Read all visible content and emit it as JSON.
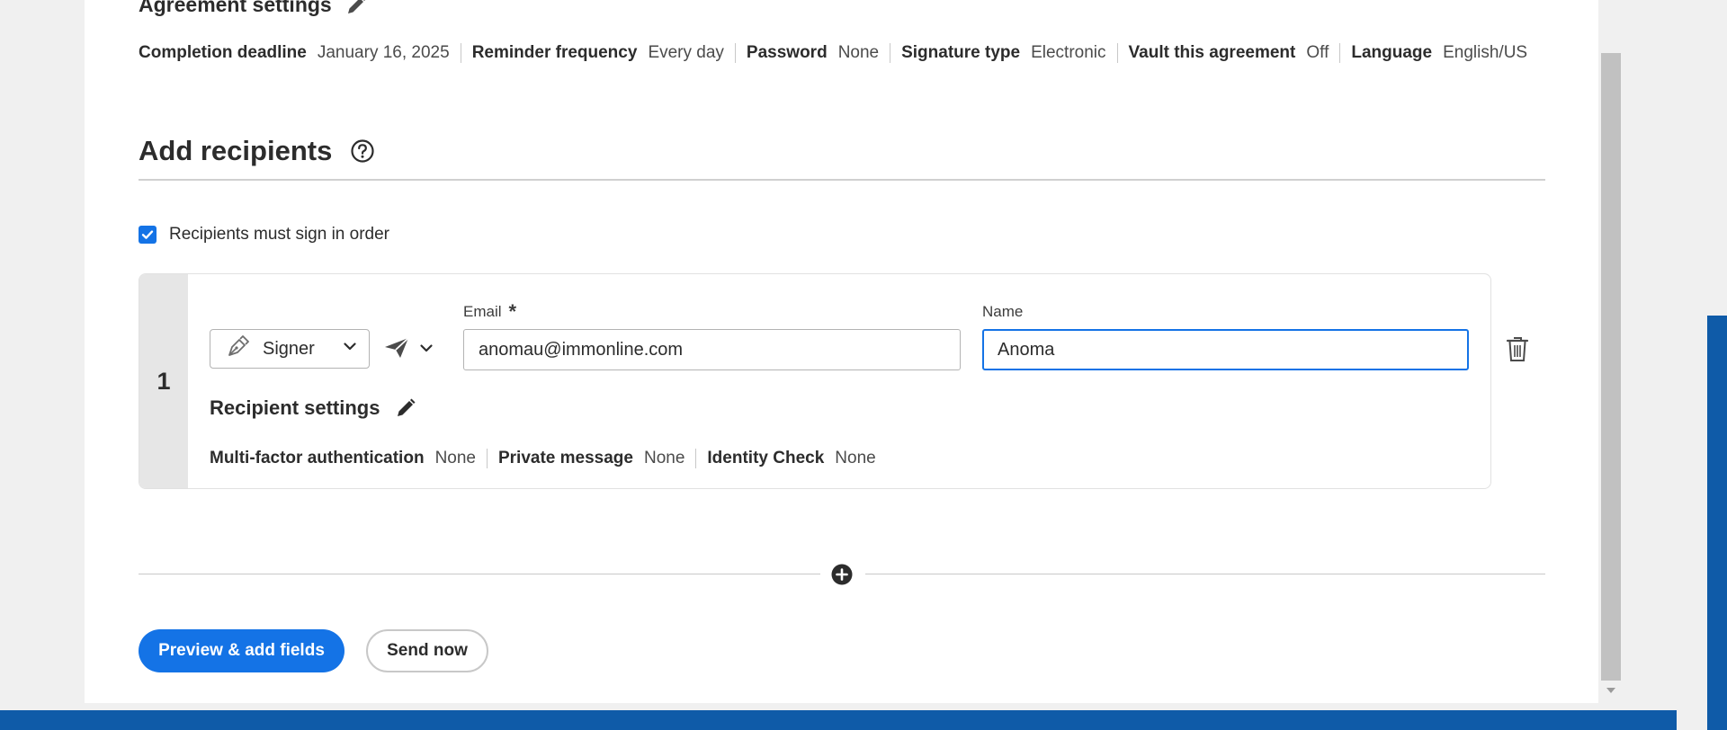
{
  "agreement": {
    "title": "Agreement settings",
    "settings": [
      {
        "label": "Completion deadline",
        "value": "January 16, 2025"
      },
      {
        "label": "Reminder frequency",
        "value": "Every day"
      },
      {
        "label": "Password",
        "value": "None"
      },
      {
        "label": "Signature type",
        "value": "Electronic"
      },
      {
        "label": "Vault this agreement",
        "value": "Off"
      },
      {
        "label": "Language",
        "value": "English/US"
      }
    ]
  },
  "recipients": {
    "title": "Add recipients",
    "sign_in_order_label": "Recipients must sign in order",
    "sign_in_order_checked": true,
    "card": {
      "number": "1",
      "role": "Signer",
      "email_label": "Email",
      "email_required_mark": "*",
      "email_value": "anomau@immonline.com",
      "name_label": "Name",
      "name_value": "Anoma",
      "settings_title": "Recipient settings",
      "settings": [
        {
          "label": "Multi-factor authentication",
          "value": "None"
        },
        {
          "label": "Private message",
          "value": "None"
        },
        {
          "label": "Identity Check",
          "value": "None"
        }
      ]
    }
  },
  "actions": {
    "preview_label": "Preview & add fields",
    "send_label": "Send now"
  },
  "colors": {
    "accent": "#1473e6",
    "brand_bar": "#0f5ba8"
  }
}
